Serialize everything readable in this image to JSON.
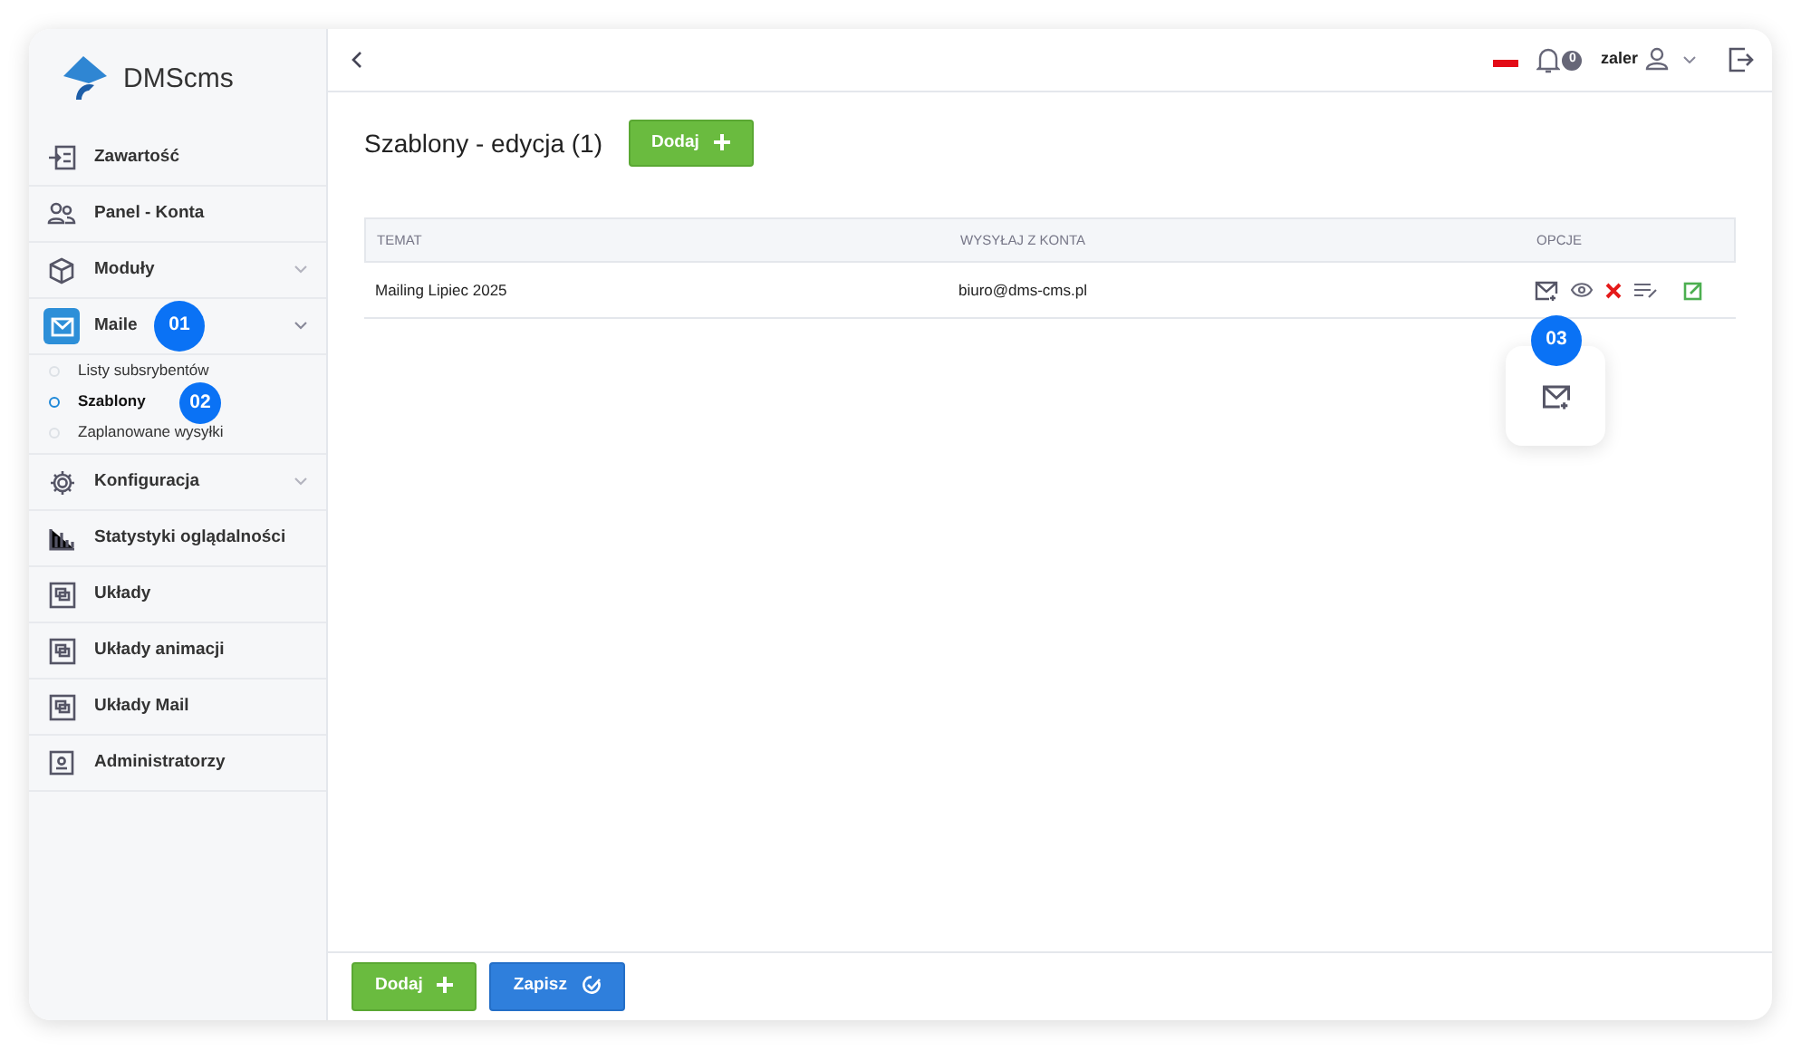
{
  "logo": {
    "text": "DMScms"
  },
  "sidebar": {
    "items": [
      {
        "label": "Zawartość",
        "kind": "item",
        "selected": false
      },
      {
        "label": "Panel - Konta",
        "kind": "item",
        "selected": false
      },
      {
        "label": "Moduły",
        "kind": "group",
        "selected": false,
        "expanded": false
      },
      {
        "label": "Maile",
        "kind": "group",
        "selected": true,
        "expanded": true,
        "children": [
          {
            "label": "Listy subsrybentów",
            "selected": false
          },
          {
            "label": "Szablony",
            "selected": true
          },
          {
            "label": "Zaplanowane wysyłki",
            "selected": false
          }
        ]
      },
      {
        "label": "Konfiguracja",
        "kind": "group",
        "selected": false,
        "expanded": false
      },
      {
        "label": "Statystyki oglądalności",
        "kind": "item",
        "selected": false
      },
      {
        "label": "Układy",
        "kind": "item",
        "selected": false
      },
      {
        "label": "Układy animacji",
        "kind": "item",
        "selected": false
      },
      {
        "label": "Układy Mail",
        "kind": "item",
        "selected": false
      },
      {
        "label": "Administratorzy",
        "kind": "item",
        "selected": false
      }
    ]
  },
  "topbar": {
    "notifications": "0",
    "user": "zaler"
  },
  "page": {
    "title": "Szablony - edycja (1)",
    "add_button": "Dodaj"
  },
  "table": {
    "columns": [
      "TEMAT",
      "WYSYŁAJ Z KONTA",
      "OPCJE"
    ],
    "rows": [
      {
        "cells": [
          "Mailing Lipiec 2025",
          "biuro@dms-cms.pl"
        ]
      }
    ]
  },
  "annotations": [
    "01",
    "02",
    "03"
  ],
  "footer": {
    "buttons": [
      {
        "label": "Dodaj",
        "kind": "add"
      },
      {
        "label": "Zapisz",
        "kind": "save"
      }
    ]
  }
}
